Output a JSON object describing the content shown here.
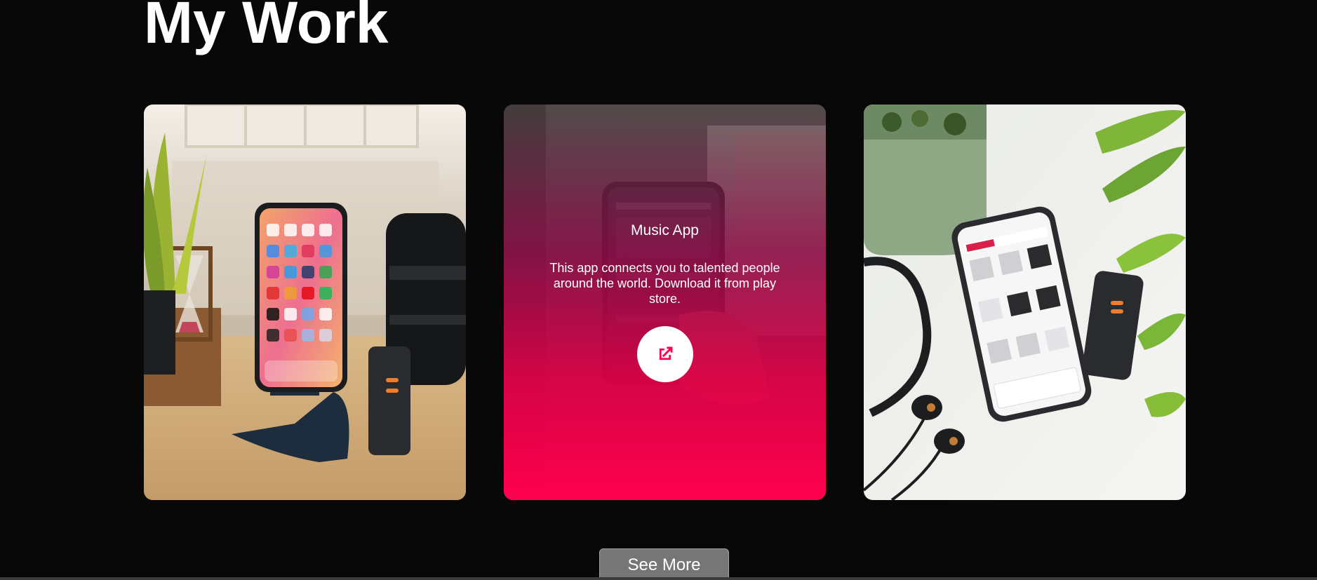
{
  "section": {
    "title": "My Work"
  },
  "work": [
    {
      "image": "phone-on-stand-with-camera-lens-photo"
    },
    {
      "image": "hand-holding-phone-music-app-photo",
      "overlay": {
        "title": "Music App",
        "description": "This app connects you to talented people around the world. Download it from play store.",
        "link_icon": "external-link-icon"
      }
    },
    {
      "image": "phone-ecommerce-store-with-earbuds-photo"
    }
  ],
  "see_more": {
    "label": "See More"
  },
  "colors": {
    "background": "#080808",
    "accent": "#ff004f",
    "button_bg": "#767676",
    "text": "#ffffff"
  }
}
